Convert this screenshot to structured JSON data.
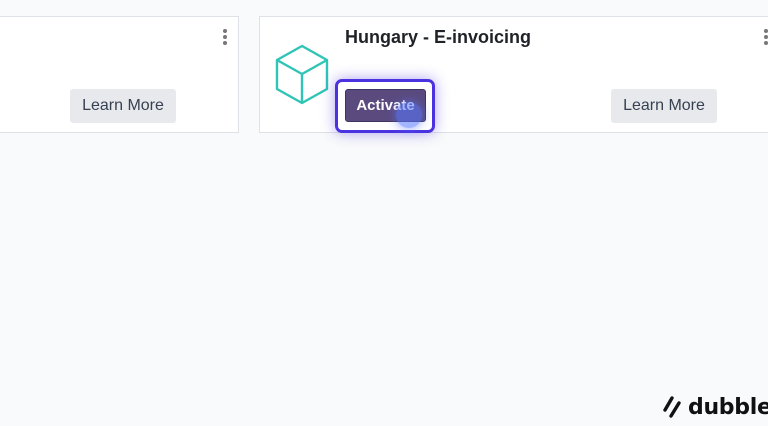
{
  "cards": {
    "left": {
      "learn_more_label": "Learn More"
    },
    "right": {
      "title": "Hungary - E-invoicing",
      "activate_label": "Activate",
      "learn_more_label": "Learn More",
      "icon": "cube-icon",
      "icon_color": "#2ec4b6"
    }
  },
  "cursor": {
    "icon": "click-indicator-icon",
    "color": "#5a78ff"
  },
  "watermark": {
    "text": "dubble",
    "icon": "dubble-logo-icon"
  },
  "colors": {
    "background": "#f9fafb",
    "activate_button": "#5a4a7e",
    "highlight": "#4b32e0"
  }
}
